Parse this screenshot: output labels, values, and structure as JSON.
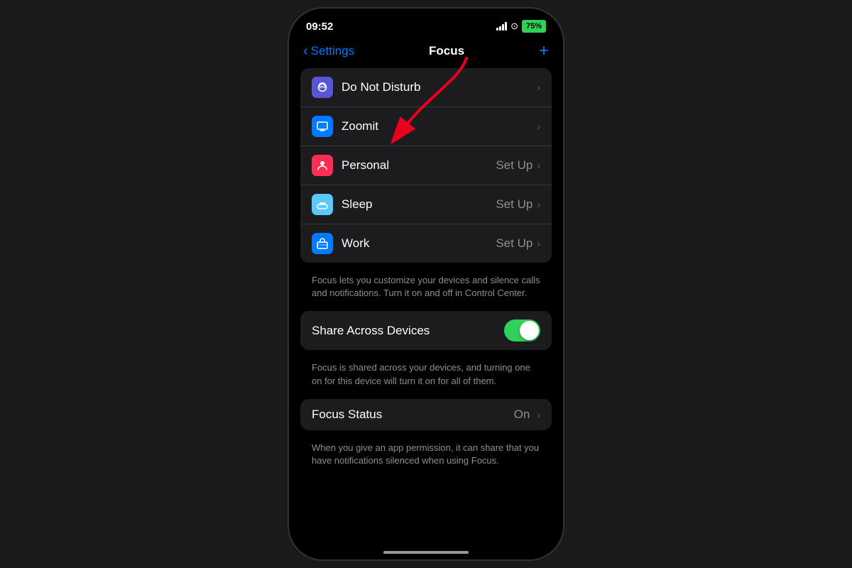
{
  "statusBar": {
    "time": "09:52",
    "battery": "75%"
  },
  "navBar": {
    "backLabel": "Settings",
    "title": "Focus",
    "addButton": "+"
  },
  "focusItems": [
    {
      "id": "do-not-disturb",
      "label": "Do Not Disturb",
      "sublabel": "",
      "iconType": "moon",
      "iconColor": "purple"
    },
    {
      "id": "zoomit",
      "label": "Zoomit",
      "sublabel": "",
      "iconType": "monitor",
      "iconColor": "blue"
    },
    {
      "id": "personal",
      "label": "Personal",
      "sublabel": "Set Up",
      "iconType": "person",
      "iconColor": "pink"
    },
    {
      "id": "sleep",
      "label": "Sleep",
      "sublabel": "Set Up",
      "iconType": "bed",
      "iconColor": "teal"
    },
    {
      "id": "work",
      "label": "Work",
      "sublabel": "Set Up",
      "iconType": "briefcase",
      "iconColor": "blue"
    }
  ],
  "description1": "Focus lets you customize your devices and silence calls and notifications. Turn it on and off in Control Center.",
  "shareAcrossDevices": {
    "label": "Share Across Devices",
    "enabled": true
  },
  "description2": "Focus is shared across your devices, and turning one on for this device will turn it on for all of them.",
  "focusStatus": {
    "label": "Focus Status",
    "value": "On"
  },
  "description3": "When you give an app permission, it can share that you have notifications silenced when using Focus."
}
